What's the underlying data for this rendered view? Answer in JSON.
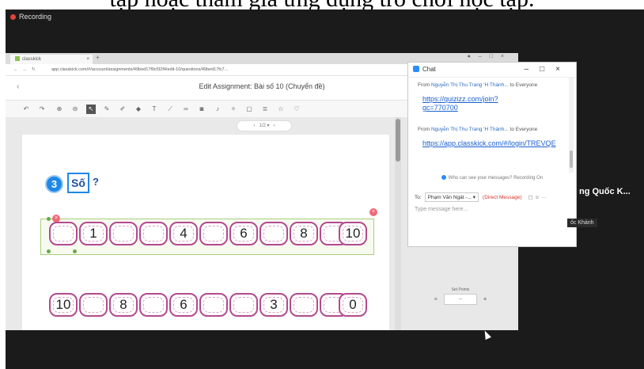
{
  "caption": "tập hoặc tham gia ứng dụng trò chơi học tập.",
  "recording_label": "Recording",
  "browser": {
    "tab_title": "classkick",
    "url": "app.classkick.com/#/account/assignments/49bed17f9cf32f4/edit-10/questions/49bed17fc7..."
  },
  "editor": {
    "title": "Edit Assignment: Bài số 10 (Chuyển đề)",
    "pager": "1/2",
    "exercise_number": "3",
    "exercise_label": "Số",
    "question_mark": "?",
    "row1": [
      "",
      "1",
      "",
      "",
      "4",
      "",
      "6",
      "",
      "8",
      "",
      "10"
    ],
    "row2": [
      "10",
      "",
      "8",
      "",
      "6",
      "",
      "",
      "3",
      "",
      "",
      "0"
    ],
    "set_points_label": "Set Points",
    "set_points_value": "--"
  },
  "chat": {
    "title": "Chat",
    "messages": [
      {
        "from_prefix": "From",
        "sender": "Nguyễn Thị Thu Trang 'H Thành...",
        "to": "to Everyone",
        "link": "https://quizizz.com/join?gc=770700"
      },
      {
        "from_prefix": "From",
        "sender": "Nguyễn Thị Thu Trang 'H Thành...",
        "to": "to Everyone",
        "link": "https://app.classkick.com/#/login/TREVQE"
      }
    ],
    "visibility_note": "Who can see your messages? Recording On",
    "to_label": "To:",
    "recipient": "Phạm Văn Ngát -...",
    "direct_message": "(Direct Message)",
    "input_placeholder": "Type message here..."
  },
  "side_participant_name": "ng Quốc K...",
  "side_participant_tag": "ốc Khánh"
}
